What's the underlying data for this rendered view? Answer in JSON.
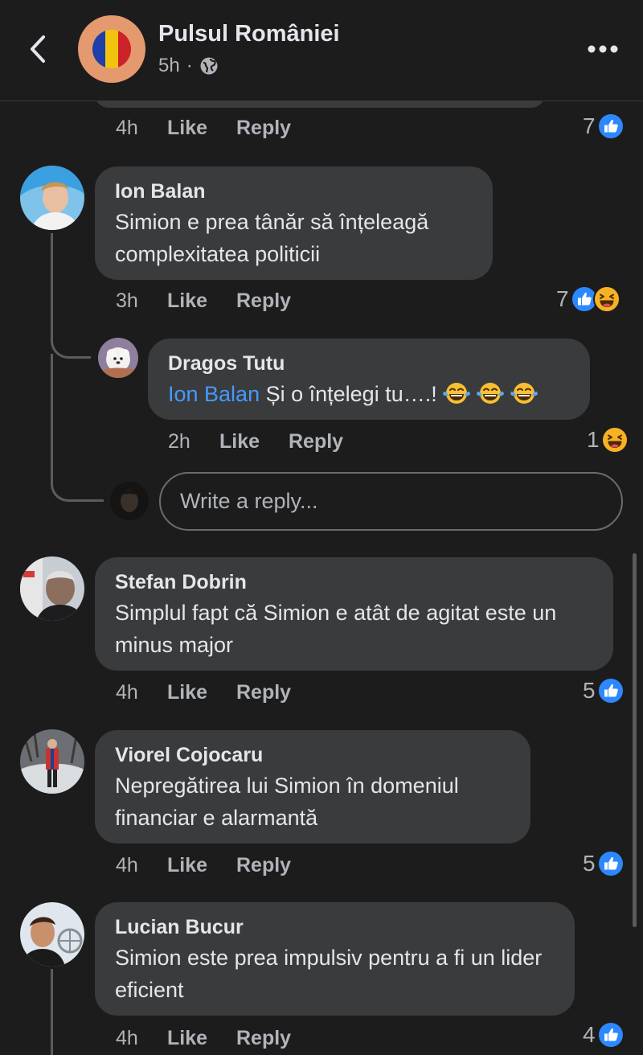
{
  "header": {
    "page_name": "Pulsul României",
    "time": "5h",
    "separator": "·",
    "privacy_icon": "globe-icon",
    "back_icon": "chevron-left-icon",
    "more_icon": "ellipsis-icon"
  },
  "colors": {
    "background": "#1c1c1d",
    "bubble": "#3a3b3c",
    "text": "#e4e6eb",
    "muted": "#b0b3b8",
    "link": "#4599ff",
    "like_blue": "#2d88ff",
    "haha_yellow": "#f7b125"
  },
  "labels": {
    "like": "Like",
    "reply": "Reply"
  },
  "top_comment": {
    "time": "4h",
    "reaction_count": "7",
    "reactions": [
      "like"
    ]
  },
  "comments": [
    {
      "author": "Ion Balan",
      "text": "Simion e prea tânăr să înțeleagă complexitatea politicii",
      "time": "3h",
      "reaction_count": "7",
      "reactions": [
        "like",
        "haha"
      ],
      "replies": [
        {
          "author": "Dragos Tutu",
          "mention": "Ion Balan",
          "text": "Și o înțelegi tu….!",
          "inline_emojis": [
            "laughing-tears-emoji",
            "laughing-tears-emoji",
            "laughing-tears-emoji"
          ],
          "time": "2h",
          "reaction_count": "1",
          "reactions": [
            "haha"
          ]
        }
      ],
      "reply_input_placeholder": "Write a reply..."
    },
    {
      "author": "Stefan Dobrin",
      "text": "Simplul fapt că Simion e atât de agitat este un minus major",
      "time": "4h",
      "reaction_count": "5",
      "reactions": [
        "like"
      ]
    },
    {
      "author": "Viorel Cojocaru",
      "text": "Nepregătirea lui Simion în domeniul financiar e alarmantă",
      "time": "4h",
      "reaction_count": "5",
      "reactions": [
        "like"
      ]
    },
    {
      "author": "Lucian Bucur",
      "text": "Simion este prea impulsiv pentru a fi un lider eficient",
      "time": "4h",
      "reaction_count": "4",
      "reactions": [
        "like"
      ]
    }
  ]
}
